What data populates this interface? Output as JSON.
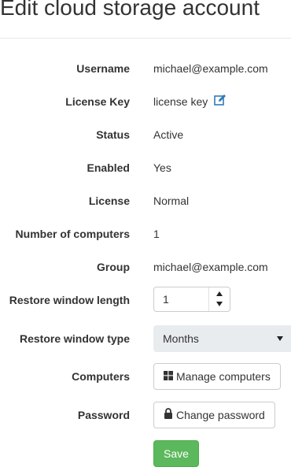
{
  "page": {
    "title": "Edit cloud storage account"
  },
  "fields": {
    "username": {
      "label": "Username",
      "value": "michael@example.com"
    },
    "license_key": {
      "label": "License Key",
      "value": "license key",
      "icon": "edit-icon"
    },
    "status": {
      "label": "Status",
      "value": "Active"
    },
    "enabled": {
      "label": "Enabled",
      "value": "Yes"
    },
    "license": {
      "label": "License",
      "value": "Normal"
    },
    "computers_count": {
      "label": "Number of computers",
      "value": "1"
    },
    "group": {
      "label": "Group",
      "value": "michael@example.com"
    },
    "restore_window_length": {
      "label": "Restore window length",
      "value": "1"
    },
    "restore_window_type": {
      "label": "Restore window type",
      "selected": "Months"
    },
    "computers": {
      "label": "Computers",
      "button_label": "Manage computers",
      "icon": "windows-icon"
    },
    "password": {
      "label": "Password",
      "button_label": "Change password",
      "icon": "lock-icon"
    }
  },
  "actions": {
    "save_label": "Save"
  },
  "colors": {
    "accent_link": "#337ab7",
    "save_green": "#5cb85c",
    "select_bg": "#e9ecef"
  }
}
